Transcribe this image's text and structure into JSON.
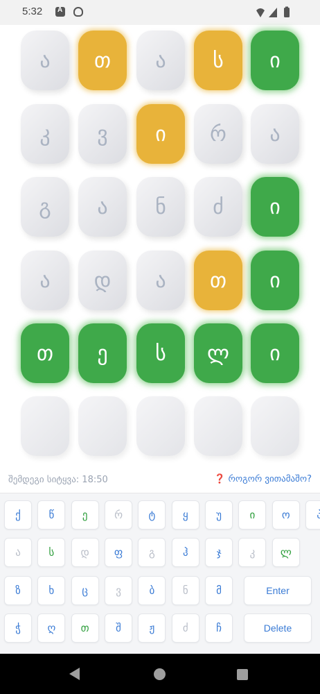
{
  "status_bar": {
    "time": "5:32",
    "notification_icons": [
      "a-icon",
      "shield-icon"
    ],
    "system_icons": [
      "wifi-icon",
      "signal-icon",
      "battery-icon"
    ]
  },
  "grid": {
    "rows": [
      [
        {
          "letter": "ა",
          "state": "absent"
        },
        {
          "letter": "თ",
          "state": "present"
        },
        {
          "letter": "ა",
          "state": "absent"
        },
        {
          "letter": "ს",
          "state": "present"
        },
        {
          "letter": "ი",
          "state": "correct"
        }
      ],
      [
        {
          "letter": "კ",
          "state": "absent"
        },
        {
          "letter": "ვ",
          "state": "absent"
        },
        {
          "letter": "ი",
          "state": "present"
        },
        {
          "letter": "რ",
          "state": "absent"
        },
        {
          "letter": "ა",
          "state": "absent"
        }
      ],
      [
        {
          "letter": "გ",
          "state": "absent"
        },
        {
          "letter": "ა",
          "state": "absent"
        },
        {
          "letter": "ნ",
          "state": "absent"
        },
        {
          "letter": "ძ",
          "state": "absent"
        },
        {
          "letter": "ი",
          "state": "correct"
        }
      ],
      [
        {
          "letter": "ა",
          "state": "absent"
        },
        {
          "letter": "დ",
          "state": "absent"
        },
        {
          "letter": "ა",
          "state": "absent"
        },
        {
          "letter": "თ",
          "state": "present"
        },
        {
          "letter": "ი",
          "state": "correct"
        }
      ],
      [
        {
          "letter": "თ",
          "state": "correct"
        },
        {
          "letter": "ე",
          "state": "correct"
        },
        {
          "letter": "ს",
          "state": "correct"
        },
        {
          "letter": "ლ",
          "state": "correct"
        },
        {
          "letter": "ი",
          "state": "correct"
        }
      ],
      [
        {
          "letter": "",
          "state": "empty"
        },
        {
          "letter": "",
          "state": "empty"
        },
        {
          "letter": "",
          "state": "empty"
        },
        {
          "letter": "",
          "state": "empty"
        },
        {
          "letter": "",
          "state": "empty"
        }
      ]
    ]
  },
  "info": {
    "next_word": "შემდეგი სიტყვა: 18:50",
    "how_to_play": "❓ როგორ ვითამაშო?"
  },
  "keyboard": {
    "rows": [
      [
        {
          "key": "ქ",
          "state": "unused"
        },
        {
          "key": "წ",
          "state": "unused"
        },
        {
          "key": "ე",
          "state": "correct"
        },
        {
          "key": "რ",
          "state": "absent"
        },
        {
          "key": "ტ",
          "state": "unused"
        },
        {
          "key": "ყ",
          "state": "unused"
        },
        {
          "key": "უ",
          "state": "unused"
        },
        {
          "key": "ი",
          "state": "correct"
        },
        {
          "key": "ო",
          "state": "unused"
        },
        {
          "key": "პ",
          "state": "unused"
        }
      ],
      [
        {
          "key": "ა",
          "state": "absent"
        },
        {
          "key": "ს",
          "state": "correct"
        },
        {
          "key": "დ",
          "state": "absent"
        },
        {
          "key": "ფ",
          "state": "unused"
        },
        {
          "key": "გ",
          "state": "absent"
        },
        {
          "key": "ჰ",
          "state": "unused"
        },
        {
          "key": "ჯ",
          "state": "unused"
        },
        {
          "key": "კ",
          "state": "absent"
        },
        {
          "key": "ლ",
          "state": "correct"
        }
      ],
      [
        {
          "key": "ზ",
          "state": "unused"
        },
        {
          "key": "ხ",
          "state": "unused"
        },
        {
          "key": "ც",
          "state": "unused"
        },
        {
          "key": "ვ",
          "state": "absent"
        },
        {
          "key": "ბ",
          "state": "unused"
        },
        {
          "key": "ნ",
          "state": "absent"
        },
        {
          "key": "მ",
          "state": "unused"
        },
        {
          "key": "Enter",
          "state": "action"
        }
      ],
      [
        {
          "key": "ჭ",
          "state": "unused"
        },
        {
          "key": "ღ",
          "state": "unused"
        },
        {
          "key": "თ",
          "state": "correct"
        },
        {
          "key": "შ",
          "state": "unused"
        },
        {
          "key": "ჟ",
          "state": "unused"
        },
        {
          "key": "ძ",
          "state": "absent"
        },
        {
          "key": "ჩ",
          "state": "unused"
        },
        {
          "key": "Delete",
          "state": "action"
        }
      ]
    ]
  },
  "colors": {
    "correct": "#3fa94a",
    "present": "#e8b33a",
    "absent_tile": "#e3e4e8",
    "key_text": "#3a7bd5",
    "key_absent": "#b9bec8",
    "key_correct": "#2e9e3c"
  },
  "nav_bar": {
    "icons": [
      "back-icon",
      "home-icon",
      "recents-icon"
    ]
  }
}
